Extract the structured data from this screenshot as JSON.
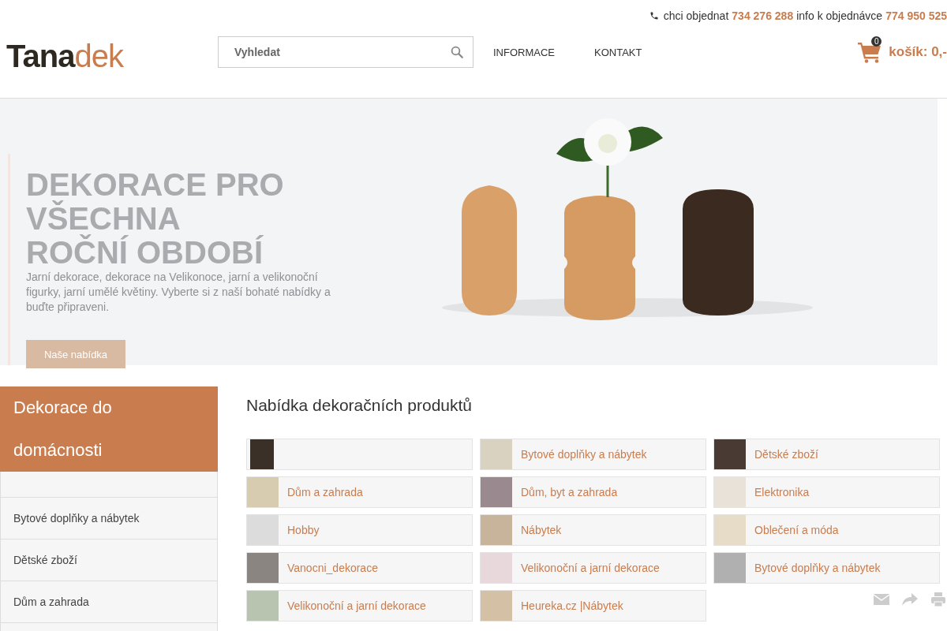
{
  "contact": {
    "order_label": "chci objednat",
    "order_phone": "734 276 288",
    "info_label": "info k objednávce",
    "info_phone": "774 950 525"
  },
  "logo": {
    "part_1": "Tana",
    "part_2": "dek"
  },
  "search": {
    "placeholder": "Vyhledat"
  },
  "nav": [
    "INFORMACE",
    "KONTAKT"
  ],
  "cart": {
    "count": "0",
    "label": "košík: 0,-"
  },
  "hero": {
    "title_lines": [
      "DEKORACE PRO",
      "VŠECHNA",
      "ROČNÍ OBDOBÍ"
    ],
    "text": "Jarní dekorace, dekorace na Velikonoce, jarní a velikonoční figurky, jarní umělé květiny. Vyberte si z naší bohaté nabídky a buďte připraveni.",
    "button": "Naše nabídka"
  },
  "sidebar": {
    "title": "Dekorace do domácnosti",
    "items": [
      "Bytové doplňky a nábytek",
      "Dětské zboží",
      "Dům a zahrada"
    ]
  },
  "main": {
    "heading": "Nabídka dekoračních produktů",
    "products": [
      {
        "kind": "image_only"
      },
      {
        "label": "Bytové doplňky a nábytek"
      },
      {
        "label": "Dětské zboží"
      },
      {
        "label": "Dům a zahrada"
      },
      {
        "label": "Dům, byt a zahrada"
      },
      {
        "label": "Elektronika"
      },
      {
        "label": "Hobby"
      },
      {
        "label": "Nábytek"
      },
      {
        "label": "Oblečení a móda"
      },
      {
        "label": "Vanocni_dekorace"
      },
      {
        "label": "Velikonoční a jarní dekorace"
      },
      {
        "label": "Bytové doplňky a nábytek"
      },
      {
        "label": "Velikonoční a jarní dekorace"
      },
      {
        "label": "Heureka.cz |Nábytek"
      }
    ]
  }
}
